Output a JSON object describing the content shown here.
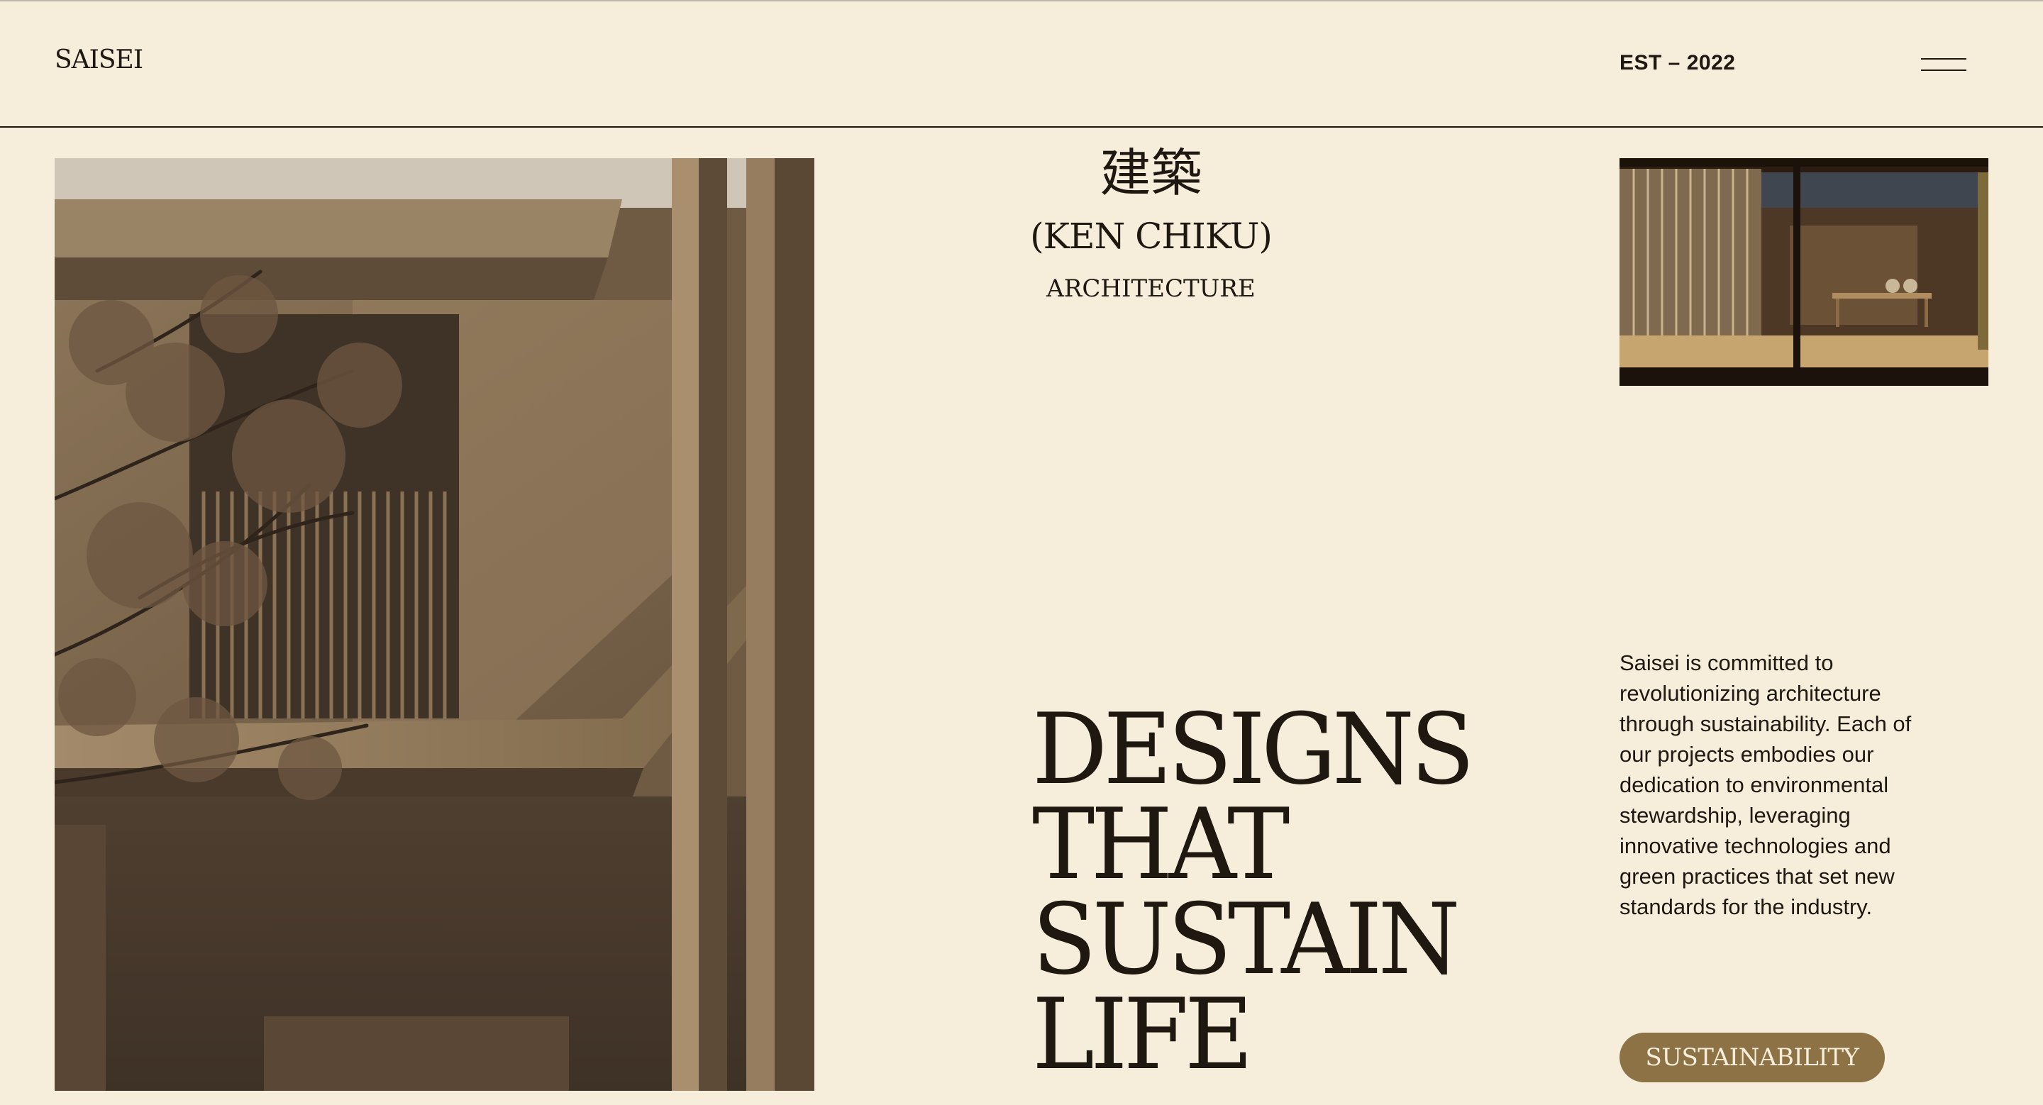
{
  "header": {
    "logo": "SAISEI",
    "est": "EST – 2022",
    "menu_icon": "hamburger-menu-icon"
  },
  "title_block": {
    "japanese": "建築",
    "romaji": "(KEN CHIKU)",
    "english": "ARCHITECTURE"
  },
  "headline": {
    "lines": [
      "DESIGNS",
      "THAT",
      "SUSTAIN",
      "LIFE"
    ]
  },
  "description": "Saisei is committed to revolutionizing architecture through sustainability. Each of our projects embodies our dedication to environmental stewardship, leveraging innovative technologies and green practices that set new standards for the industry.",
  "cta": {
    "label": "SUSTAINABILITY"
  },
  "colors": {
    "background": "#f6eeda",
    "text": "#1e1811",
    "accent": "#8c7245"
  }
}
